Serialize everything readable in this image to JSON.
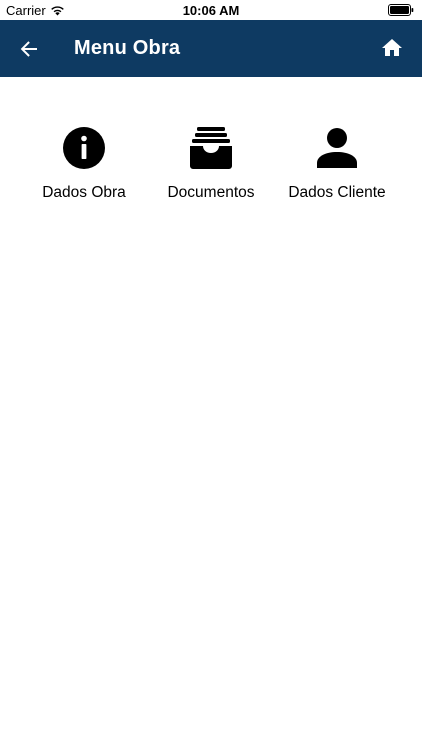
{
  "status_bar": {
    "carrier": "Carrier",
    "time": "10:06 AM",
    "icons": [
      "wifi-icon",
      "battery-icon"
    ]
  },
  "app_bar": {
    "title": "Menu Obra",
    "background_color": "#0e3a62",
    "back_icon": "arrow-left-icon",
    "home_icon": "home-icon"
  },
  "menu": {
    "items": [
      {
        "label": "Dados Obra",
        "icon": "info-circle-icon"
      },
      {
        "label": "Documentos",
        "icon": "inbox-tray-icon"
      },
      {
        "label": "Dados Cliente",
        "icon": "user-icon"
      }
    ]
  }
}
